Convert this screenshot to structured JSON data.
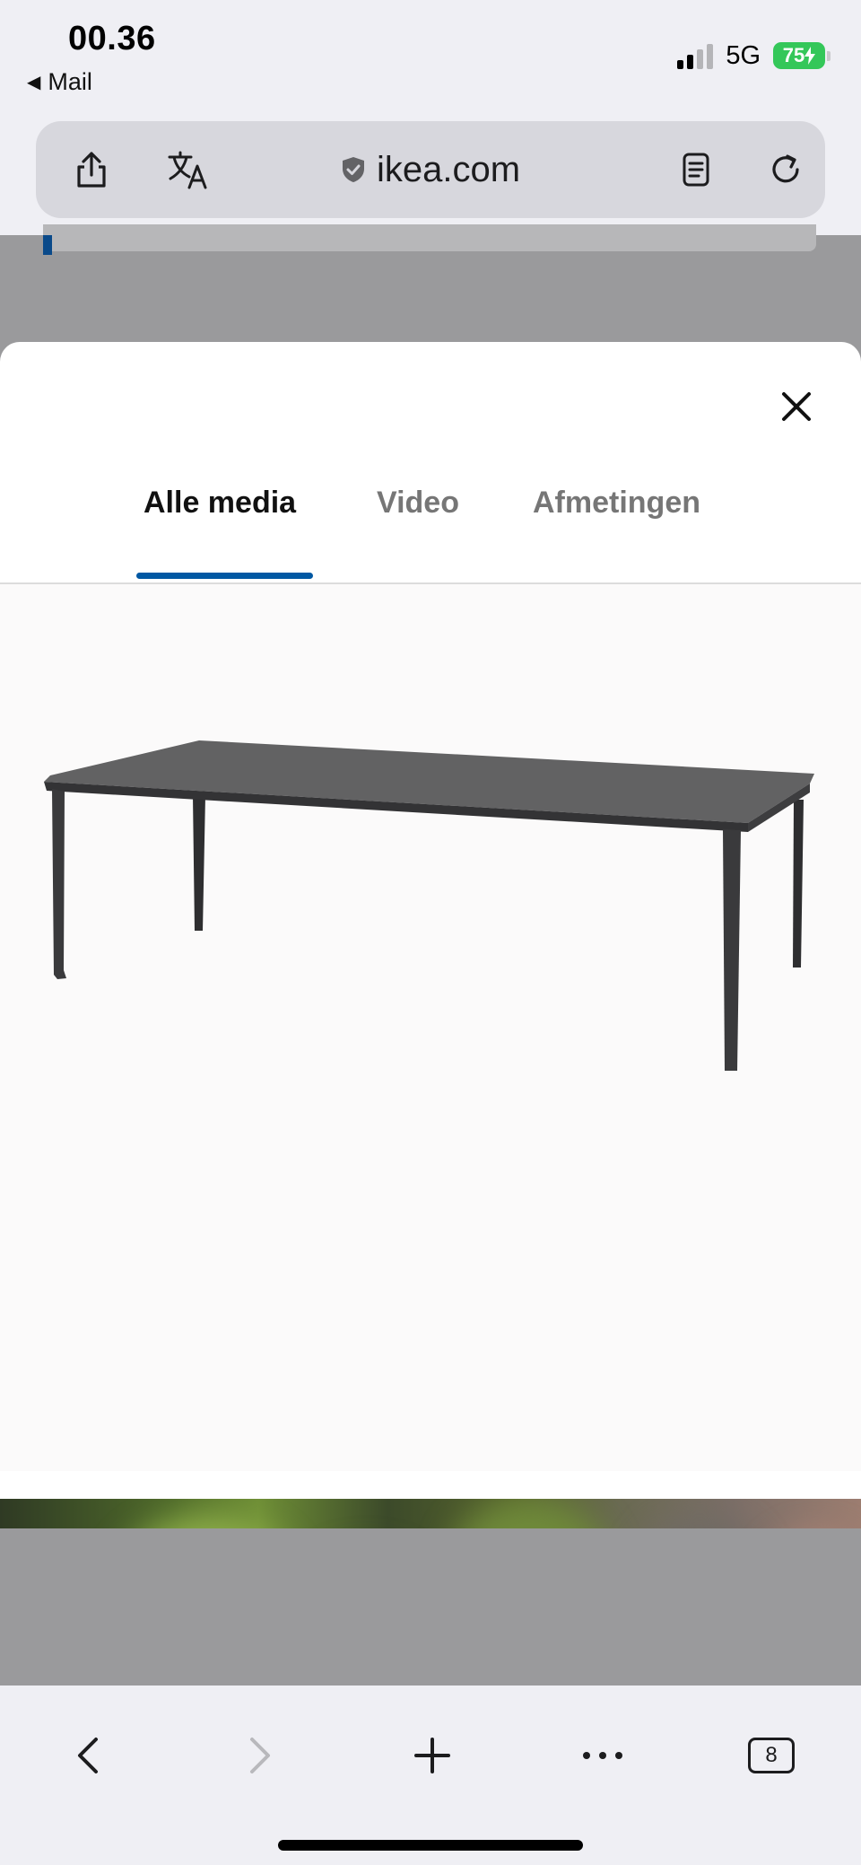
{
  "status_bar": {
    "time": "00.36",
    "back_app": "Mail",
    "network": "5G",
    "battery": "75"
  },
  "address_bar": {
    "url": "ikea.com"
  },
  "modal": {
    "tabs": [
      {
        "label": "Alle media",
        "active": true
      },
      {
        "label": "Video",
        "active": false
      },
      {
        "label": "Afmetingen",
        "active": false
      }
    ]
  },
  "toolbar": {
    "tabs_count": "8"
  },
  "colors": {
    "accent": "#0058a3",
    "battery": "#34c759"
  },
  "icons": [
    "share-icon",
    "translate-icon",
    "shield-icon",
    "reader-icon",
    "reload-icon",
    "close-icon",
    "back-icon",
    "forward-icon",
    "plus-icon",
    "more-icon",
    "tabs-icon"
  ]
}
